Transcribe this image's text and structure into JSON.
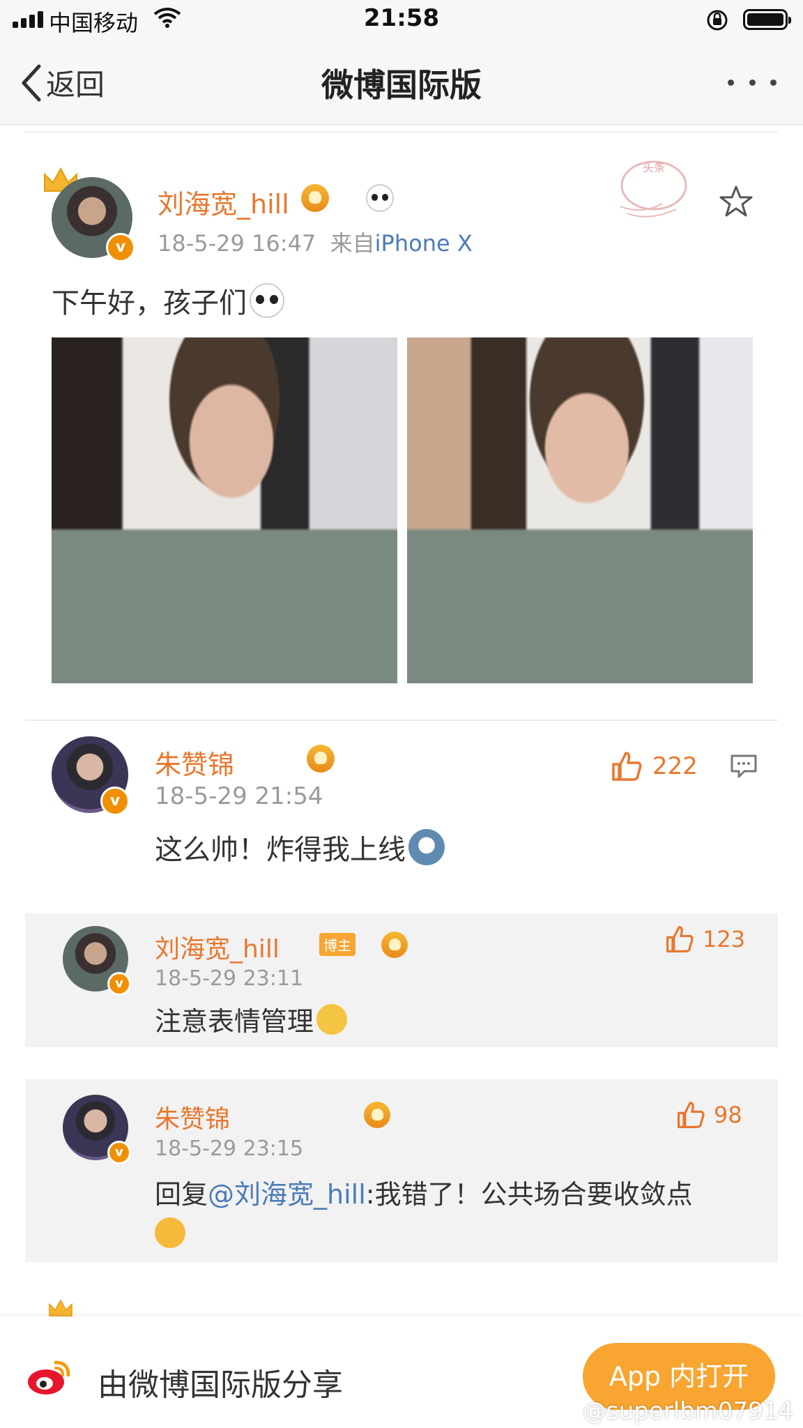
{
  "status_bar": {
    "carrier": "中国移动",
    "time": "21:58"
  },
  "nav": {
    "back_label": "返回",
    "title": "微博国际版"
  },
  "post": {
    "author": "刘海宽_hill",
    "time": "18-5-29 16:47",
    "source_prefix": "来自",
    "source_device": "iPhone X",
    "text": "下午好，孩子们",
    "stamp_text": "头条"
  },
  "comments": [
    {
      "author": "朱赞锦",
      "time": "18-5-29 21:54",
      "likes": "222",
      "text": "这么帅！炸得我上线"
    }
  ],
  "replies": [
    {
      "author": "刘海宽_hill",
      "badge": "博主",
      "time": "18-5-29 23:11",
      "likes": "123",
      "text": "注意表情管理"
    },
    {
      "author": "朱赞锦",
      "time": "18-5-29 23:15",
      "likes": "98",
      "reply_prefix": "回复",
      "mention": "@刘海宽_hill",
      "text": ":我错了！公共场合要收敛点"
    }
  ],
  "footer": {
    "share_text": "由微博国际版分享",
    "open_button": "App 内打开",
    "watermark": "@superlbm07914"
  },
  "colors": {
    "name_orange": "#e8772e",
    "link_blue": "#4a7bb7",
    "button_orange": "#f8a531",
    "reply_bg": "#f2f2f2"
  }
}
